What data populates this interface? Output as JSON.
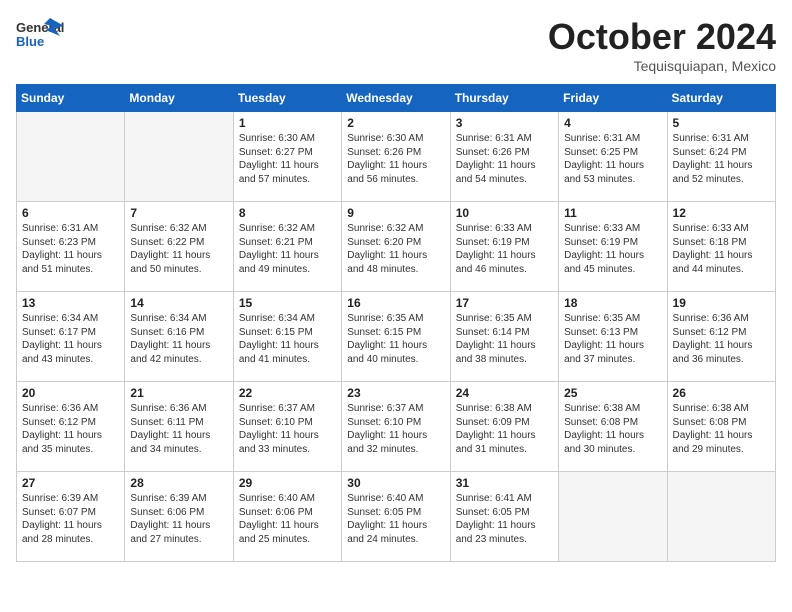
{
  "logo": {
    "general": "General",
    "blue": "Blue",
    "alt": "GeneralBlue logo"
  },
  "header": {
    "month": "October 2024",
    "location": "Tequisquiapan, Mexico"
  },
  "weekdays": [
    "Sunday",
    "Monday",
    "Tuesday",
    "Wednesday",
    "Thursday",
    "Friday",
    "Saturday"
  ],
  "weeks": [
    [
      {
        "day": "",
        "empty": true
      },
      {
        "day": "",
        "empty": true
      },
      {
        "day": "1",
        "sunrise": "6:30 AM",
        "sunset": "6:27 PM",
        "daylight": "11 hours and 57 minutes."
      },
      {
        "day": "2",
        "sunrise": "6:30 AM",
        "sunset": "6:26 PM",
        "daylight": "11 hours and 56 minutes."
      },
      {
        "day": "3",
        "sunrise": "6:31 AM",
        "sunset": "6:26 PM",
        "daylight": "11 hours and 54 minutes."
      },
      {
        "day": "4",
        "sunrise": "6:31 AM",
        "sunset": "6:25 PM",
        "daylight": "11 hours and 53 minutes."
      },
      {
        "day": "5",
        "sunrise": "6:31 AM",
        "sunset": "6:24 PM",
        "daylight": "11 hours and 52 minutes."
      }
    ],
    [
      {
        "day": "6",
        "sunrise": "6:31 AM",
        "sunset": "6:23 PM",
        "daylight": "11 hours and 51 minutes."
      },
      {
        "day": "7",
        "sunrise": "6:32 AM",
        "sunset": "6:22 PM",
        "daylight": "11 hours and 50 minutes."
      },
      {
        "day": "8",
        "sunrise": "6:32 AM",
        "sunset": "6:21 PM",
        "daylight": "11 hours and 49 minutes."
      },
      {
        "day": "9",
        "sunrise": "6:32 AM",
        "sunset": "6:20 PM",
        "daylight": "11 hours and 48 minutes."
      },
      {
        "day": "10",
        "sunrise": "6:33 AM",
        "sunset": "6:19 PM",
        "daylight": "11 hours and 46 minutes."
      },
      {
        "day": "11",
        "sunrise": "6:33 AM",
        "sunset": "6:19 PM",
        "daylight": "11 hours and 45 minutes."
      },
      {
        "day": "12",
        "sunrise": "6:33 AM",
        "sunset": "6:18 PM",
        "daylight": "11 hours and 44 minutes."
      }
    ],
    [
      {
        "day": "13",
        "sunrise": "6:34 AM",
        "sunset": "6:17 PM",
        "daylight": "11 hours and 43 minutes."
      },
      {
        "day": "14",
        "sunrise": "6:34 AM",
        "sunset": "6:16 PM",
        "daylight": "11 hours and 42 minutes."
      },
      {
        "day": "15",
        "sunrise": "6:34 AM",
        "sunset": "6:15 PM",
        "daylight": "11 hours and 41 minutes."
      },
      {
        "day": "16",
        "sunrise": "6:35 AM",
        "sunset": "6:15 PM",
        "daylight": "11 hours and 40 minutes."
      },
      {
        "day": "17",
        "sunrise": "6:35 AM",
        "sunset": "6:14 PM",
        "daylight": "11 hours and 38 minutes."
      },
      {
        "day": "18",
        "sunrise": "6:35 AM",
        "sunset": "6:13 PM",
        "daylight": "11 hours and 37 minutes."
      },
      {
        "day": "19",
        "sunrise": "6:36 AM",
        "sunset": "6:12 PM",
        "daylight": "11 hours and 36 minutes."
      }
    ],
    [
      {
        "day": "20",
        "sunrise": "6:36 AM",
        "sunset": "6:12 PM",
        "daylight": "11 hours and 35 minutes."
      },
      {
        "day": "21",
        "sunrise": "6:36 AM",
        "sunset": "6:11 PM",
        "daylight": "11 hours and 34 minutes."
      },
      {
        "day": "22",
        "sunrise": "6:37 AM",
        "sunset": "6:10 PM",
        "daylight": "11 hours and 33 minutes."
      },
      {
        "day": "23",
        "sunrise": "6:37 AM",
        "sunset": "6:10 PM",
        "daylight": "11 hours and 32 minutes."
      },
      {
        "day": "24",
        "sunrise": "6:38 AM",
        "sunset": "6:09 PM",
        "daylight": "11 hours and 31 minutes."
      },
      {
        "day": "25",
        "sunrise": "6:38 AM",
        "sunset": "6:08 PM",
        "daylight": "11 hours and 30 minutes."
      },
      {
        "day": "26",
        "sunrise": "6:38 AM",
        "sunset": "6:08 PM",
        "daylight": "11 hours and 29 minutes."
      }
    ],
    [
      {
        "day": "27",
        "sunrise": "6:39 AM",
        "sunset": "6:07 PM",
        "daylight": "11 hours and 28 minutes."
      },
      {
        "day": "28",
        "sunrise": "6:39 AM",
        "sunset": "6:06 PM",
        "daylight": "11 hours and 27 minutes."
      },
      {
        "day": "29",
        "sunrise": "6:40 AM",
        "sunset": "6:06 PM",
        "daylight": "11 hours and 25 minutes."
      },
      {
        "day": "30",
        "sunrise": "6:40 AM",
        "sunset": "6:05 PM",
        "daylight": "11 hours and 24 minutes."
      },
      {
        "day": "31",
        "sunrise": "6:41 AM",
        "sunset": "6:05 PM",
        "daylight": "11 hours and 23 minutes."
      },
      {
        "day": "",
        "empty": true
      },
      {
        "day": "",
        "empty": true
      }
    ]
  ]
}
